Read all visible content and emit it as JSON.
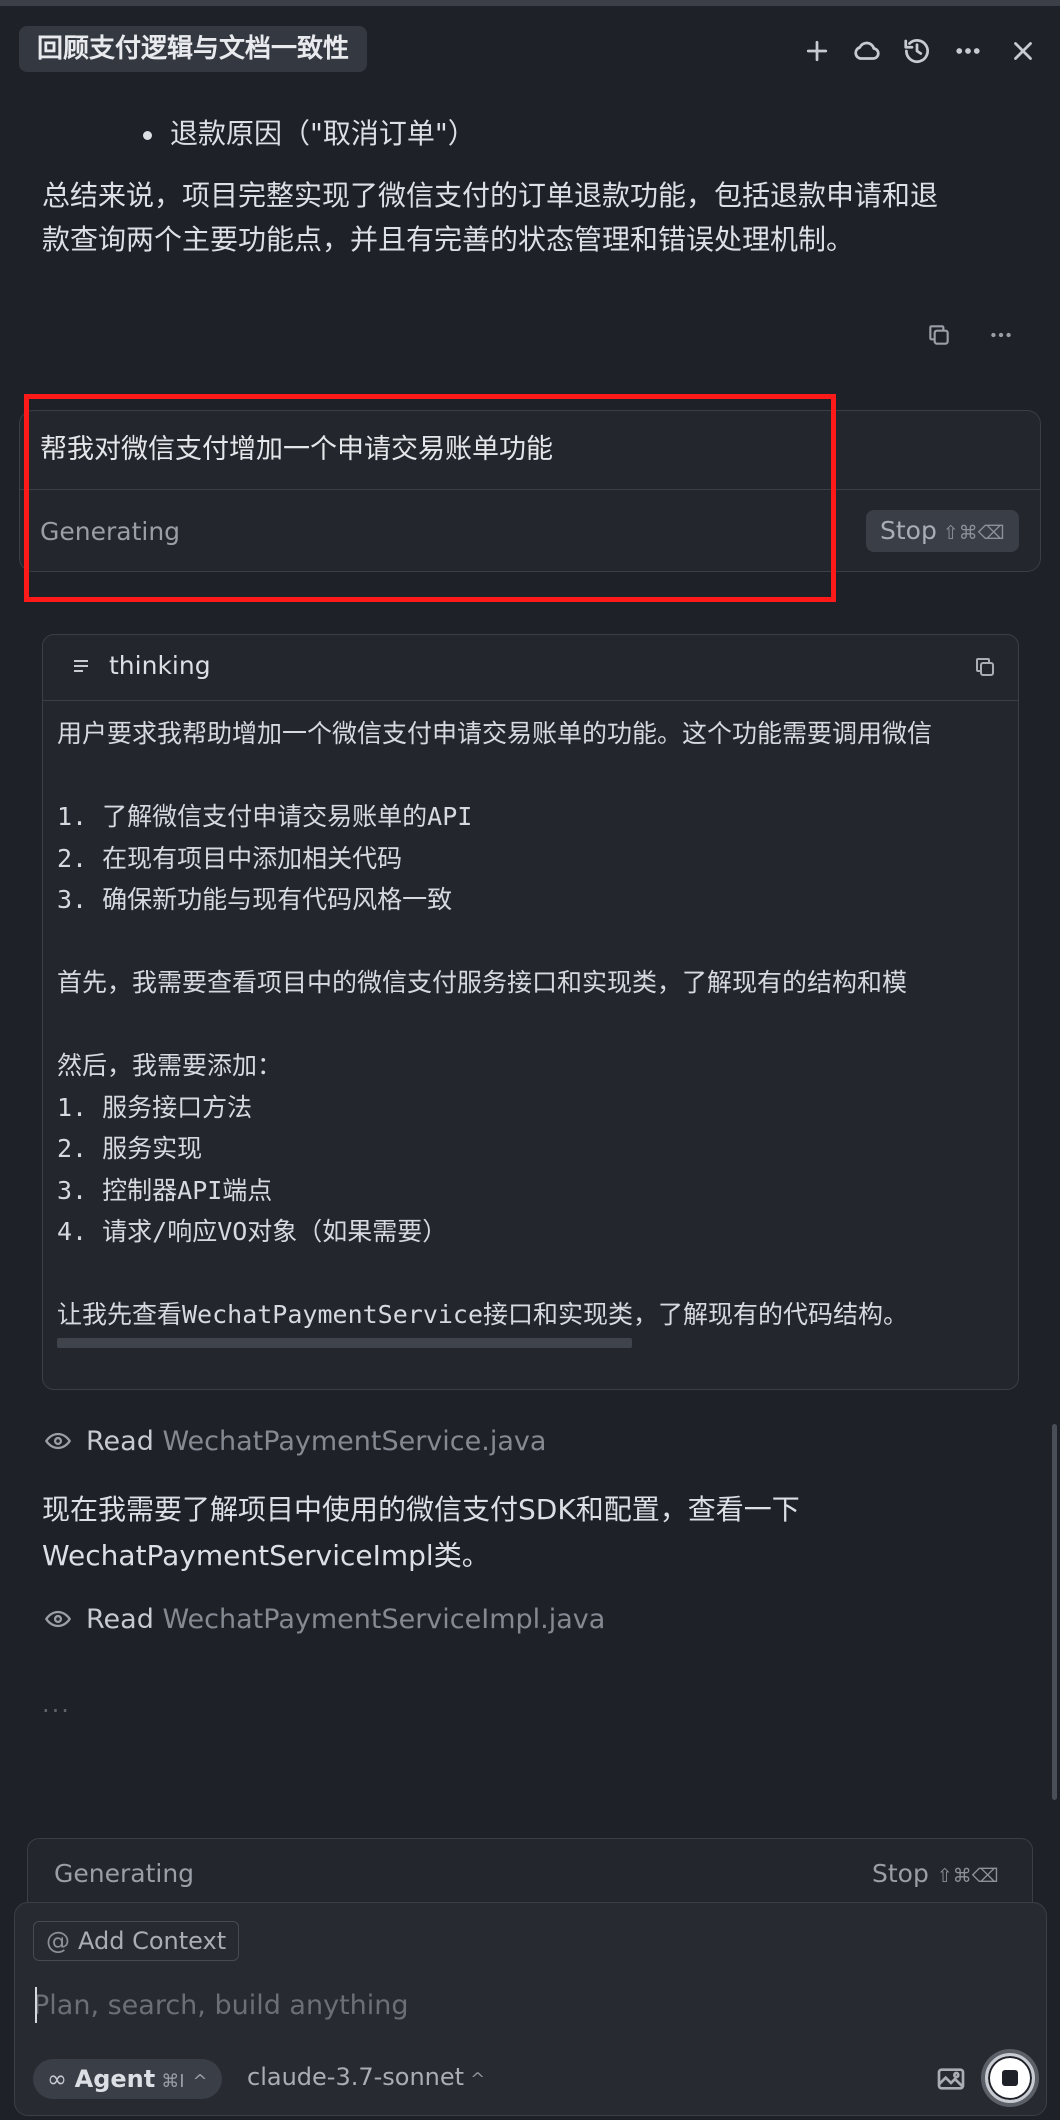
{
  "header": {
    "title": "回顾支付逻辑与文档一致性",
    "icons": [
      "plus-icon",
      "cloud-icon",
      "history-icon",
      "more-icon",
      "close-icon"
    ]
  },
  "previous_response": {
    "bullet": "退款原因（\"取消订单\"）",
    "summary_line1": "总结来说，项目完整实现了微信支付的订单退款功能，包括退款申请和退",
    "summary_line2": "款查询两个主要功能点，并且有完善的状态管理和错误处理机制。"
  },
  "user_message": {
    "text": "帮我对微信支付增加一个申请交易账单功能",
    "status": "Generating",
    "stop_label": "Stop",
    "stop_shortcut": "⇧⌘⌫"
  },
  "thinking": {
    "label": "thinking",
    "body": "用户要求我帮助增加一个微信支付申请交易账单的功能。这个功能需要调用微信\n\n1. 了解微信支付申请交易账单的API\n2. 在现有项目中添加相关代码\n3. 确保新功能与现有代码风格一致\n\n首先，我需要查看项目中的微信支付服务接口和实现类，了解现有的结构和模\n\n然后，我需要添加：\n1. 服务接口方法\n2. 服务实现\n3. 控制器API端点\n4. 请求/响应VO对象（如果需要）\n\n让我先查看WechatPaymentService接口和实现类，了解现有的代码结构。"
  },
  "read1": {
    "verb": "Read",
    "file": "WechatPaymentService.java"
  },
  "middle_text": {
    "line1": "现在我需要了解项目中使用的微信支付SDK和配置，查看一下",
    "line2": "WechatPaymentServiceImpl类。"
  },
  "read2": {
    "verb": "Read",
    "file": "WechatPaymentServiceImpl.java"
  },
  "ellipsis": "...",
  "bottom_status": {
    "status": "Generating",
    "stop_label": "Stop",
    "stop_shortcut": "⇧⌘⌫"
  },
  "composer": {
    "add_context": "Add Context",
    "placeholder": "Plan, search, build anything",
    "agent_label": "Agent",
    "agent_shortcut": "⌘I",
    "model": "claude-3.7-sonnet"
  }
}
